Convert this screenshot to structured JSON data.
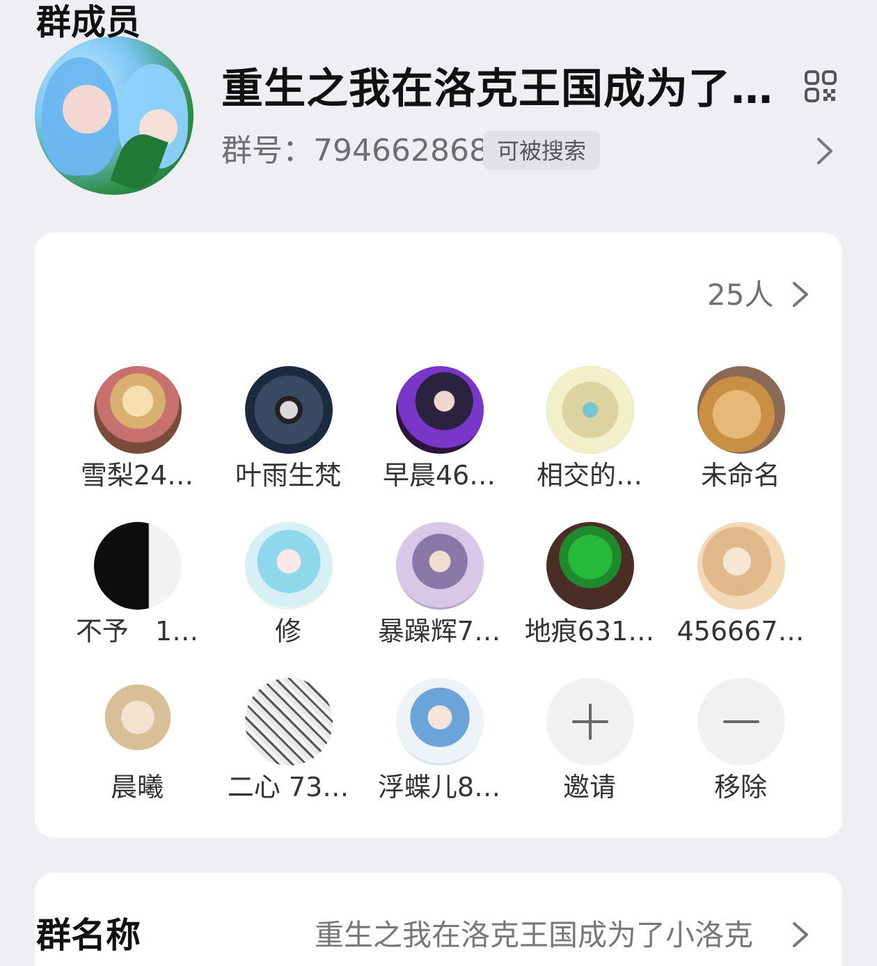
{
  "header": {
    "group_name": "重生之我在洛克王国成为了…",
    "group_id_text": "群号：794662868",
    "search_badge": "可被搜索",
    "qr_icon": "qr-code-icon",
    "chevron_icon": "chevron-right-icon"
  },
  "members_card": {
    "title": "群成员",
    "count": "25人",
    "members": [
      {
        "name": "雪梨24…"
      },
      {
        "name": "叶雨生梵"
      },
      {
        "name": "早晨46…"
      },
      {
        "name": "相交的…"
      },
      {
        "name": "未命名"
      },
      {
        "name": "不予　1…"
      },
      {
        "name": "修"
      },
      {
        "name": "暴躁辉7…"
      },
      {
        "name": "地痕631…"
      },
      {
        "name": "456667…"
      },
      {
        "name": "晨曦"
      },
      {
        "name": "二心 73…"
      },
      {
        "name": "浮蝶儿8…"
      }
    ],
    "invite_label": "邀请",
    "remove_label": "移除"
  },
  "name_card": {
    "title": "群名称",
    "value": "重生之我在洛克王国成为了小洛克"
  }
}
